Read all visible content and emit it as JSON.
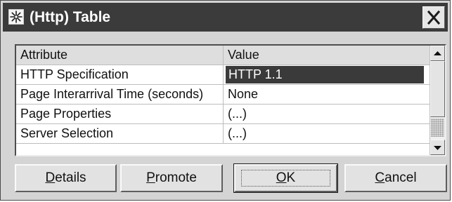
{
  "window": {
    "title": "(Http) Table",
    "icons": {
      "app": "star-icon",
      "close": "close-icon"
    }
  },
  "table": {
    "headers": [
      "Attribute",
      "Value"
    ],
    "rows": [
      {
        "attribute": "HTTP Specification",
        "value": "HTTP 1.1",
        "selected": true
      },
      {
        "attribute": "Page Interarrival Time (seconds)",
        "value": "None"
      },
      {
        "attribute": "Page Properties",
        "value": "(...)"
      },
      {
        "attribute": "Server Selection",
        "value": "(...)"
      }
    ]
  },
  "buttons": {
    "details": {
      "mnemonic": "D",
      "rest": "etails"
    },
    "promote": {
      "mnemonic": "P",
      "rest": "romote"
    },
    "ok": {
      "mnemonic": "O",
      "rest": "K"
    },
    "cancel": {
      "mnemonic": "C",
      "rest": "ancel"
    }
  },
  "colors": {
    "titlebar": "#3b3b3b",
    "selection": "#3a3a3a",
    "dialog_bg": "#d4d4d4"
  }
}
